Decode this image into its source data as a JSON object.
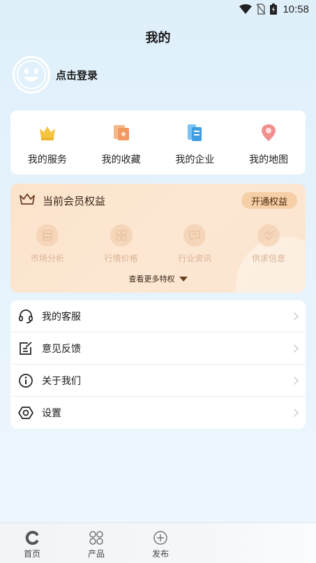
{
  "status_bar": {
    "time": "10:58"
  },
  "header": {
    "title": "我的"
  },
  "login": {
    "label": "点击登录"
  },
  "quick_links": [
    {
      "label": "我的服务",
      "icon": "crown-service-icon",
      "color": "#f5c542"
    },
    {
      "label": "我的收藏",
      "icon": "bookmark-icon",
      "color": "#f0a070"
    },
    {
      "label": "我的企业",
      "icon": "enterprise-doc-icon",
      "color": "#4aa8e8"
    },
    {
      "label": "我的地图",
      "icon": "map-pin-icon",
      "color": "#f07a7a"
    }
  ],
  "membership": {
    "title": "当前会员权益",
    "open_button": "开通权益",
    "perks": [
      {
        "label": "市场分析",
        "icon": "database-icon"
      },
      {
        "label": "行情价格",
        "icon": "grid-icon"
      },
      {
        "label": "行业资讯",
        "icon": "message-icon"
      },
      {
        "label": "供求信息",
        "icon": "handshake-icon"
      }
    ],
    "more_label": "查看更多特权"
  },
  "menu": [
    {
      "label": "我的客服",
      "icon": "headset-icon"
    },
    {
      "label": "意见反馈",
      "icon": "feedback-edit-icon"
    },
    {
      "label": "关于我们",
      "icon": "info-icon"
    },
    {
      "label": "设置",
      "icon": "settings-hex-icon"
    }
  ],
  "tabs": [
    {
      "label": "首页",
      "icon": "home-c-icon"
    },
    {
      "label": "产品",
      "icon": "products-grid-icon"
    },
    {
      "label": "发布",
      "icon": "publish-plus-icon"
    }
  ],
  "colors": {
    "accent_orange": "#f6cfa6",
    "member_bg": "#fbe3cb",
    "page_bg": "#dff0fb"
  }
}
